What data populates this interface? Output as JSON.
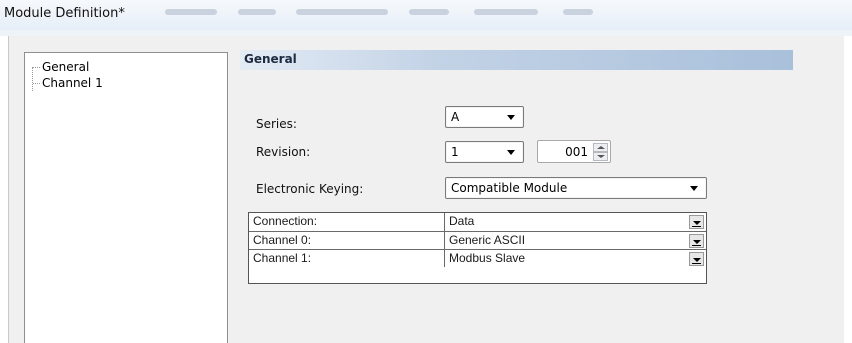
{
  "window": {
    "title": "Module Definition*"
  },
  "tree": {
    "items": [
      {
        "label": "General"
      },
      {
        "label": "Channel 1"
      }
    ]
  },
  "section": {
    "title": "General"
  },
  "series": {
    "label": "Series:",
    "value": "A"
  },
  "revision": {
    "label": "Revision:",
    "major": "1",
    "minor": "001"
  },
  "keying": {
    "label": "Electronic Keying:",
    "value": "Compatible Module"
  },
  "connections": {
    "rows": [
      {
        "label": "Connection:",
        "value": "Data"
      },
      {
        "label": "Channel 0:",
        "value": "Generic ASCII"
      },
      {
        "label": "Channel 1:",
        "value": "Modbus Slave"
      }
    ]
  },
  "colors": {
    "header_gradient_start": "#e3ebf5",
    "header_gradient_end": "#a9c0db",
    "dialog_bg": "#f0f0f0"
  }
}
